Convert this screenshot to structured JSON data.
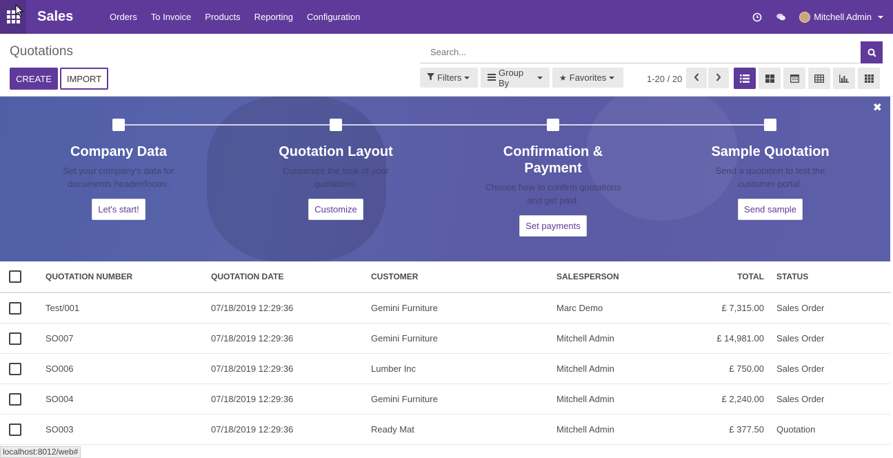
{
  "navbar": {
    "app_name": "Sales",
    "menu": [
      "Orders",
      "To Invoice",
      "Products",
      "Reporting",
      "Configuration"
    ],
    "user_name": "Mitchell Admin"
  },
  "control_panel": {
    "title": "Quotations",
    "create_label": "CREATE",
    "import_label": "IMPORT",
    "search_placeholder": "Search...",
    "filters_label": "Filters",
    "groupby_label": "Group By",
    "favorites_label": "Favorites",
    "pager": "1-20 / 20"
  },
  "banner": {
    "steps": [
      {
        "title": "Company Data",
        "desc": "Set your company's data for documents header/footer.",
        "button": "Let's start!"
      },
      {
        "title": "Quotation Layout",
        "desc": "Customize the look of your quotations.",
        "button": "Customize"
      },
      {
        "title": "Confirmation & Payment",
        "desc": "Choose how to confirm quotations and get paid.",
        "button": "Set payments"
      },
      {
        "title": "Sample Quotation",
        "desc": "Send a quotation to test the customer portal.",
        "button": "Send sample"
      }
    ]
  },
  "table": {
    "headers": {
      "number": "QUOTATION NUMBER",
      "date": "QUOTATION DATE",
      "customer": "CUSTOMER",
      "salesperson": "SALESPERSON",
      "total": "TOTAL",
      "status": "STATUS"
    },
    "rows": [
      {
        "number": "Test/001",
        "date": "07/18/2019 12:29:36",
        "customer": "Gemini Furniture",
        "salesperson": "Marc Demo",
        "total": "£ 7,315.00",
        "status": "Sales Order"
      },
      {
        "number": "SO007",
        "date": "07/18/2019 12:29:36",
        "customer": "Gemini Furniture",
        "salesperson": "Mitchell Admin",
        "total": "£ 14,981.00",
        "status": "Sales Order"
      },
      {
        "number": "SO006",
        "date": "07/18/2019 12:29:36",
        "customer": "Lumber Inc",
        "salesperson": "Mitchell Admin",
        "total": "£ 750.00",
        "status": "Sales Order"
      },
      {
        "number": "SO004",
        "date": "07/18/2019 12:29:36",
        "customer": "Gemini Furniture",
        "salesperson": "Mitchell Admin",
        "total": "£ 2,240.00",
        "status": "Sales Order"
      },
      {
        "number": "SO003",
        "date": "07/18/2019 12:29:36",
        "customer": "Ready Mat",
        "salesperson": "Mitchell Admin",
        "total": "£ 377.50",
        "status": "Quotation"
      }
    ]
  },
  "statusbar": "localhost:8012/web#",
  "colors": {
    "brand": "#5f3a9a",
    "banner": "#5a63aa"
  }
}
